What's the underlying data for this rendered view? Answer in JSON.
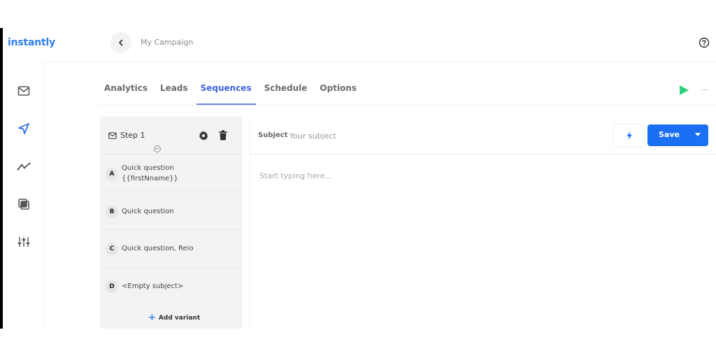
{
  "app": {
    "logo": "instantly"
  },
  "header": {
    "back_icon": "chevron-left-icon",
    "campaign_name": "My Campaign",
    "help_icon": "question-circle-icon"
  },
  "sidebar": {
    "items": [
      {
        "name": "inbox",
        "icon": "mail-icon",
        "active": false
      },
      {
        "name": "campaigns",
        "icon": "send-icon",
        "active": true
      },
      {
        "name": "analytics",
        "icon": "trend-line-icon",
        "active": false
      },
      {
        "name": "templates",
        "icon": "copy-layers-icon",
        "active": false
      },
      {
        "name": "settings",
        "icon": "sliders-icon",
        "active": false
      }
    ],
    "accent_color": "#2f6fe0"
  },
  "tabs": [
    {
      "label": "Analytics",
      "active": false
    },
    {
      "label": "Leads",
      "active": false
    },
    {
      "label": "Sequences",
      "active": true
    },
    {
      "label": "Schedule",
      "active": false
    },
    {
      "label": "Options",
      "active": false
    }
  ],
  "toolbar": {
    "play_icon": "play-icon",
    "more_label": "···"
  },
  "steps": {
    "step_title": "Step 1",
    "variants": [
      {
        "letter": "A",
        "subject": "Quick question {{firstNname}}"
      },
      {
        "letter": "B",
        "subject": "Quick question"
      },
      {
        "letter": "C",
        "subject": "Quick question, Reio"
      },
      {
        "letter": "D",
        "subject": "<Empty subject>"
      }
    ],
    "add_variant_label": "Add variant"
  },
  "editor": {
    "subject_label": "Subject",
    "subject_value": "",
    "subject_placeholder": "Your subject",
    "body_value": "",
    "body_placeholder": "Start typing here...",
    "save_label": "Save",
    "save_color": "#1a6ff2"
  }
}
